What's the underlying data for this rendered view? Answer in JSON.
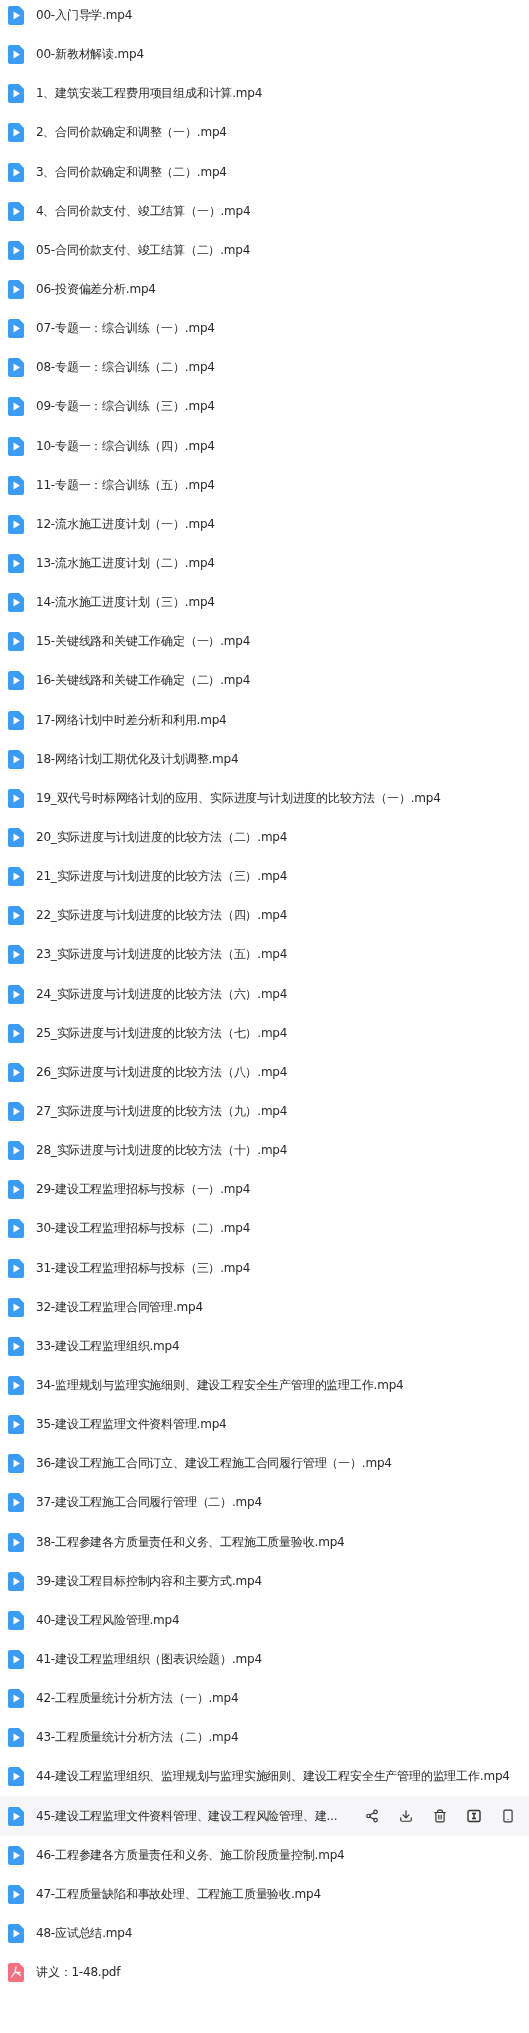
{
  "files": [
    {
      "name": "00-入门导学.mp4",
      "kind": "video",
      "hovered": false
    },
    {
      "name": "00-新教材解读.mp4",
      "kind": "video",
      "hovered": false
    },
    {
      "name": "1、建筑安装工程费用项目组成和计算.mp4",
      "kind": "video",
      "hovered": false
    },
    {
      "name": "2、合同价款确定和调整（一）.mp4",
      "kind": "video",
      "hovered": false
    },
    {
      "name": "3、合同价款确定和调整（二）.mp4",
      "kind": "video",
      "hovered": false
    },
    {
      "name": "4、合同价款支付、竣工结算（一）.mp4",
      "kind": "video",
      "hovered": false
    },
    {
      "name": "05-合同价款支付、竣工结算（二）.mp4",
      "kind": "video",
      "hovered": false
    },
    {
      "name": "06-投资偏差分析.mp4",
      "kind": "video",
      "hovered": false
    },
    {
      "name": "07-专题一：综合训练（一）.mp4",
      "kind": "video",
      "hovered": false
    },
    {
      "name": "08-专题一：综合训练（二）.mp4",
      "kind": "video",
      "hovered": false
    },
    {
      "name": "09-专题一：综合训练（三）.mp4",
      "kind": "video",
      "hovered": false
    },
    {
      "name": "10-专题一：综合训练（四）.mp4",
      "kind": "video",
      "hovered": false
    },
    {
      "name": "11-专题一：综合训练（五）.mp4",
      "kind": "video",
      "hovered": false
    },
    {
      "name": "12-流水施工进度计划（一）.mp4",
      "kind": "video",
      "hovered": false
    },
    {
      "name": "13-流水施工进度计划（二）.mp4",
      "kind": "video",
      "hovered": false
    },
    {
      "name": "14-流水施工进度计划（三）.mp4",
      "kind": "video",
      "hovered": false
    },
    {
      "name": "15-关键线路和关键工作确定（一）.mp4",
      "kind": "video",
      "hovered": false
    },
    {
      "name": "16-关键线路和关键工作确定（二）.mp4",
      "kind": "video",
      "hovered": false
    },
    {
      "name": "17-网络计划中时差分析和利用.mp4",
      "kind": "video",
      "hovered": false
    },
    {
      "name": "18-网络计划工期优化及计划调整.mp4",
      "kind": "video",
      "hovered": false
    },
    {
      "name": "19_双代号时标网络计划的应用、实际进度与计划进度的比较方法（一）.mp4",
      "kind": "video",
      "hovered": false
    },
    {
      "name": "20_实际进度与计划进度的比较方法（二）.mp4",
      "kind": "video",
      "hovered": false
    },
    {
      "name": "21_实际进度与计划进度的比较方法（三）.mp4",
      "kind": "video",
      "hovered": false
    },
    {
      "name": "22_实际进度与计划进度的比较方法（四）.mp4",
      "kind": "video",
      "hovered": false
    },
    {
      "name": "23_实际进度与计划进度的比较方法（五）.mp4",
      "kind": "video",
      "hovered": false
    },
    {
      "name": "24_实际进度与计划进度的比较方法（六）.mp4",
      "kind": "video",
      "hovered": false
    },
    {
      "name": "25_实际进度与计划进度的比较方法（七）.mp4",
      "kind": "video",
      "hovered": false
    },
    {
      "name": "26_实际进度与计划进度的比较方法（八）.mp4",
      "kind": "video",
      "hovered": false
    },
    {
      "name": "27_实际进度与计划进度的比较方法（九）.mp4",
      "kind": "video",
      "hovered": false
    },
    {
      "name": "28_实际进度与计划进度的比较方法（十）.mp4",
      "kind": "video",
      "hovered": false
    },
    {
      "name": "29-建设工程监理招标与投标（一）.mp4",
      "kind": "video",
      "hovered": false
    },
    {
      "name": "30-建设工程监理招标与投标（二）.mp4",
      "kind": "video",
      "hovered": false
    },
    {
      "name": "31-建设工程监理招标与投标（三）.mp4",
      "kind": "video",
      "hovered": false
    },
    {
      "name": "32-建设工程监理合同管理.mp4",
      "kind": "video",
      "hovered": false
    },
    {
      "name": "33-建设工程监理组织.mp4",
      "kind": "video",
      "hovered": false
    },
    {
      "name": "34-监理规划与监理实施细则、建设工程安全生产管理的监理工作.mp4",
      "kind": "video",
      "hovered": false
    },
    {
      "name": "35-建设工程监理文件资料管理.mp4",
      "kind": "video",
      "hovered": false
    },
    {
      "name": "36-建设工程施工合同订立、建设工程施工合同履行管理（一）.mp4",
      "kind": "video",
      "hovered": false
    },
    {
      "name": "37-建设工程施工合同履行管理（二）.mp4",
      "kind": "video",
      "hovered": false
    },
    {
      "name": "38-工程参建各方质量责任和义务、工程施工质量验收.mp4",
      "kind": "video",
      "hovered": false
    },
    {
      "name": "39-建设工程目标控制内容和主要方式.mp4",
      "kind": "video",
      "hovered": false
    },
    {
      "name": "40-建设工程风险管理.mp4",
      "kind": "video",
      "hovered": false
    },
    {
      "name": "41-建设工程监理组织（图表识绘题）.mp4",
      "kind": "video",
      "hovered": false
    },
    {
      "name": "42-工程质量统计分析方法（一）.mp4",
      "kind": "video",
      "hovered": false
    },
    {
      "name": "43-工程质量统计分析方法（二）.mp4",
      "kind": "video",
      "hovered": false
    },
    {
      "name": "44-建设工程监理组织、监理规划与监理实施细则、建设工程安全生产管理的监理工作.mp4",
      "kind": "video",
      "hovered": false
    },
    {
      "name": "45-建设工程监理文件资料管理、建设工程风险管理、建...",
      "kind": "video",
      "hovered": true
    },
    {
      "name": "46-工程参建各方质量责任和义务、施工阶段质量控制.mp4",
      "kind": "video",
      "hovered": false
    },
    {
      "name": "47-工程质量缺陷和事故处理、工程施工质量验收.mp4",
      "kind": "video",
      "hovered": false
    },
    {
      "name": "48-应试总结.mp4",
      "kind": "video",
      "hovered": false
    },
    {
      "name": "讲义：1-48.pdf",
      "kind": "pdf",
      "hovered": false
    }
  ]
}
